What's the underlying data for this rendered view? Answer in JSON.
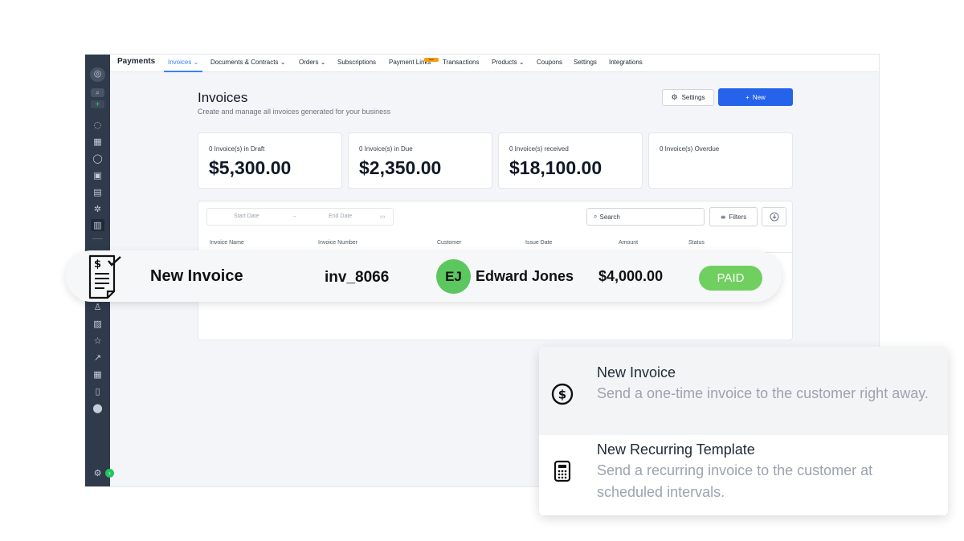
{
  "app": {
    "brand": "Payments",
    "nav": [
      {
        "label": "Invoices",
        "active": true
      },
      {
        "label": "Documents & Contracts"
      },
      {
        "label": "Orders"
      },
      {
        "label": "Subscriptions"
      },
      {
        "label": "Payment Links",
        "badge": "New"
      },
      {
        "label": "Transactions"
      },
      {
        "label": "Products"
      },
      {
        "label": "Coupons"
      },
      {
        "label": "Settings"
      },
      {
        "label": "Integrations"
      }
    ],
    "page_title": "Invoices",
    "page_subtitle": "Create and manage all invoices generated for your business",
    "settings_label": "Settings",
    "new_label": "New",
    "cards": [
      {
        "label": "0 Invoice(s) in Draft",
        "value": "$5,300.00"
      },
      {
        "label": "0 Invoice(s) in Due",
        "value": "$2,350.00"
      },
      {
        "label": "0 Invoice(s) received",
        "value": "$18,100.00"
      },
      {
        "label": "0 Invoice(s) Overdue",
        "value": ""
      }
    ],
    "start_date_placeholder": "Start Date",
    "end_date_placeholder": "End Date",
    "search_placeholder": "Search",
    "filters_label": "Filters",
    "columns": [
      "Invoice Name",
      "Invoice Number",
      "Customer",
      "Issue Date",
      "Amount",
      "Status"
    ]
  },
  "highlight_row": {
    "name": "New Invoice",
    "number": "inv_8066",
    "avatar_initials": "EJ",
    "customer": "Edward Jones",
    "amount": "$4,000.00",
    "status": "PAID",
    "status_color": "#6fcf5f"
  },
  "popover": {
    "items": [
      {
        "title": "New Invoice",
        "desc": "Send a one-time invoice to the customer right away.",
        "icon": "dollar-circle-icon"
      },
      {
        "title": "New Recurring Template",
        "desc": "Send a recurring invoice to the customer at scheduled intervals.",
        "icon": "calculator-icon"
      }
    ]
  },
  "colors": {
    "accent": "#2563eb",
    "sidebar": "#2f3a4a",
    "paid": "#6fcf5f",
    "avatar": "#5cc65f"
  }
}
